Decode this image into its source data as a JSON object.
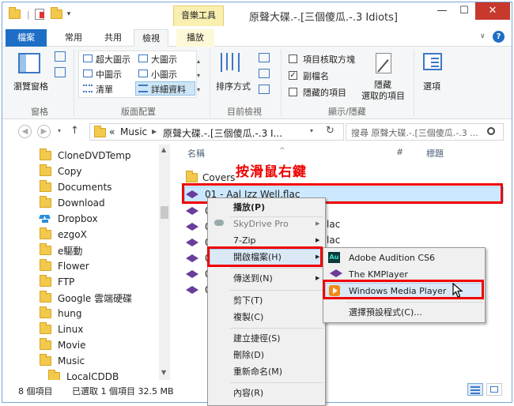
{
  "window": {
    "title": "原聲大碟.-.[三個傻瓜.-.3 Idiots]",
    "context_tab_group": "音樂工具",
    "minimize": "—",
    "maximize": "☐",
    "close": "✕"
  },
  "tabs": {
    "file": "檔案",
    "home": "常用",
    "share": "共用",
    "view": "檢視",
    "play": "播放"
  },
  "ribbon": {
    "nav_pane": "瀏覽窗格",
    "panes_group": "窗格",
    "layout": {
      "xl_icons": "超大圖示",
      "large_icons": "大圖示",
      "medium_icons": "中圖示",
      "small_icons": "小圖示",
      "list": "清單",
      "details": "詳細資料"
    },
    "layout_group": "版面配置",
    "sort_by": "排序方式",
    "current_view_group": "目前檢視",
    "item_checkboxes": "項目核取方塊",
    "file_extensions": "副檔名",
    "hidden_items": "隱藏的項目",
    "hide_selected_line1": "隱藏",
    "hide_selected_line2": "選取的項目",
    "show_hide_group": "顯示/隱藏",
    "options": "選項"
  },
  "address": {
    "path_prefix": "«",
    "path_music": "Music",
    "path_folder": "原聲大碟.-.[三個傻瓜.-.3 I...",
    "search_placeholder": "搜尋 原聲大碟.-.[三個傻瓜.-.3 ..."
  },
  "sidebar": {
    "items": [
      {
        "label": "CloneDVDTemp"
      },
      {
        "label": "Copy"
      },
      {
        "label": "Documents"
      },
      {
        "label": "Download"
      },
      {
        "label": "Dropbox"
      },
      {
        "label": "ezgoX"
      },
      {
        "label": "e驅動"
      },
      {
        "label": "Flower"
      },
      {
        "label": "FTP"
      },
      {
        "label": "Google 雲端硬碟"
      },
      {
        "label": "hung"
      },
      {
        "label": "Linux"
      },
      {
        "label": "Movie"
      },
      {
        "label": "Music"
      },
      {
        "label": "LocalCDDB"
      }
    ]
  },
  "list": {
    "col_name": "名稱",
    "col_number": "#",
    "col_title": "標題",
    "folder": "Covers",
    "selected_file": "01 - Aal Izz Well.flac",
    "partial_0": "0",
    "partial_flac": "lac"
  },
  "annotation": "按滑鼠右鍵",
  "context_menu": {
    "play": "播放(P)",
    "skydrive": "SkyDrive Pro",
    "sevenzip": "7-Zip",
    "open_with": "開啟檔案(H)",
    "send_to": "傳送到(N)",
    "cut": "剪下(T)",
    "copy": "複製(C)",
    "create_shortcut": "建立捷徑(S)",
    "delete": "刪除(D)",
    "rename": "重新命名(M)",
    "properties": "內容(R)"
  },
  "open_with_menu": {
    "audition": "Adobe Audition CS6",
    "kmplayer": "The KMPlayer",
    "wmp": "Windows Media Player",
    "choose_default": "選擇預設程式(C)..."
  },
  "status": {
    "item_count": "8 個項目",
    "selection": "已選取 1 個項目 32.5 MB"
  },
  "colors": {
    "accent": "#1e6ec6",
    "highlight": "#e00000",
    "selection": "#cce8ff"
  }
}
